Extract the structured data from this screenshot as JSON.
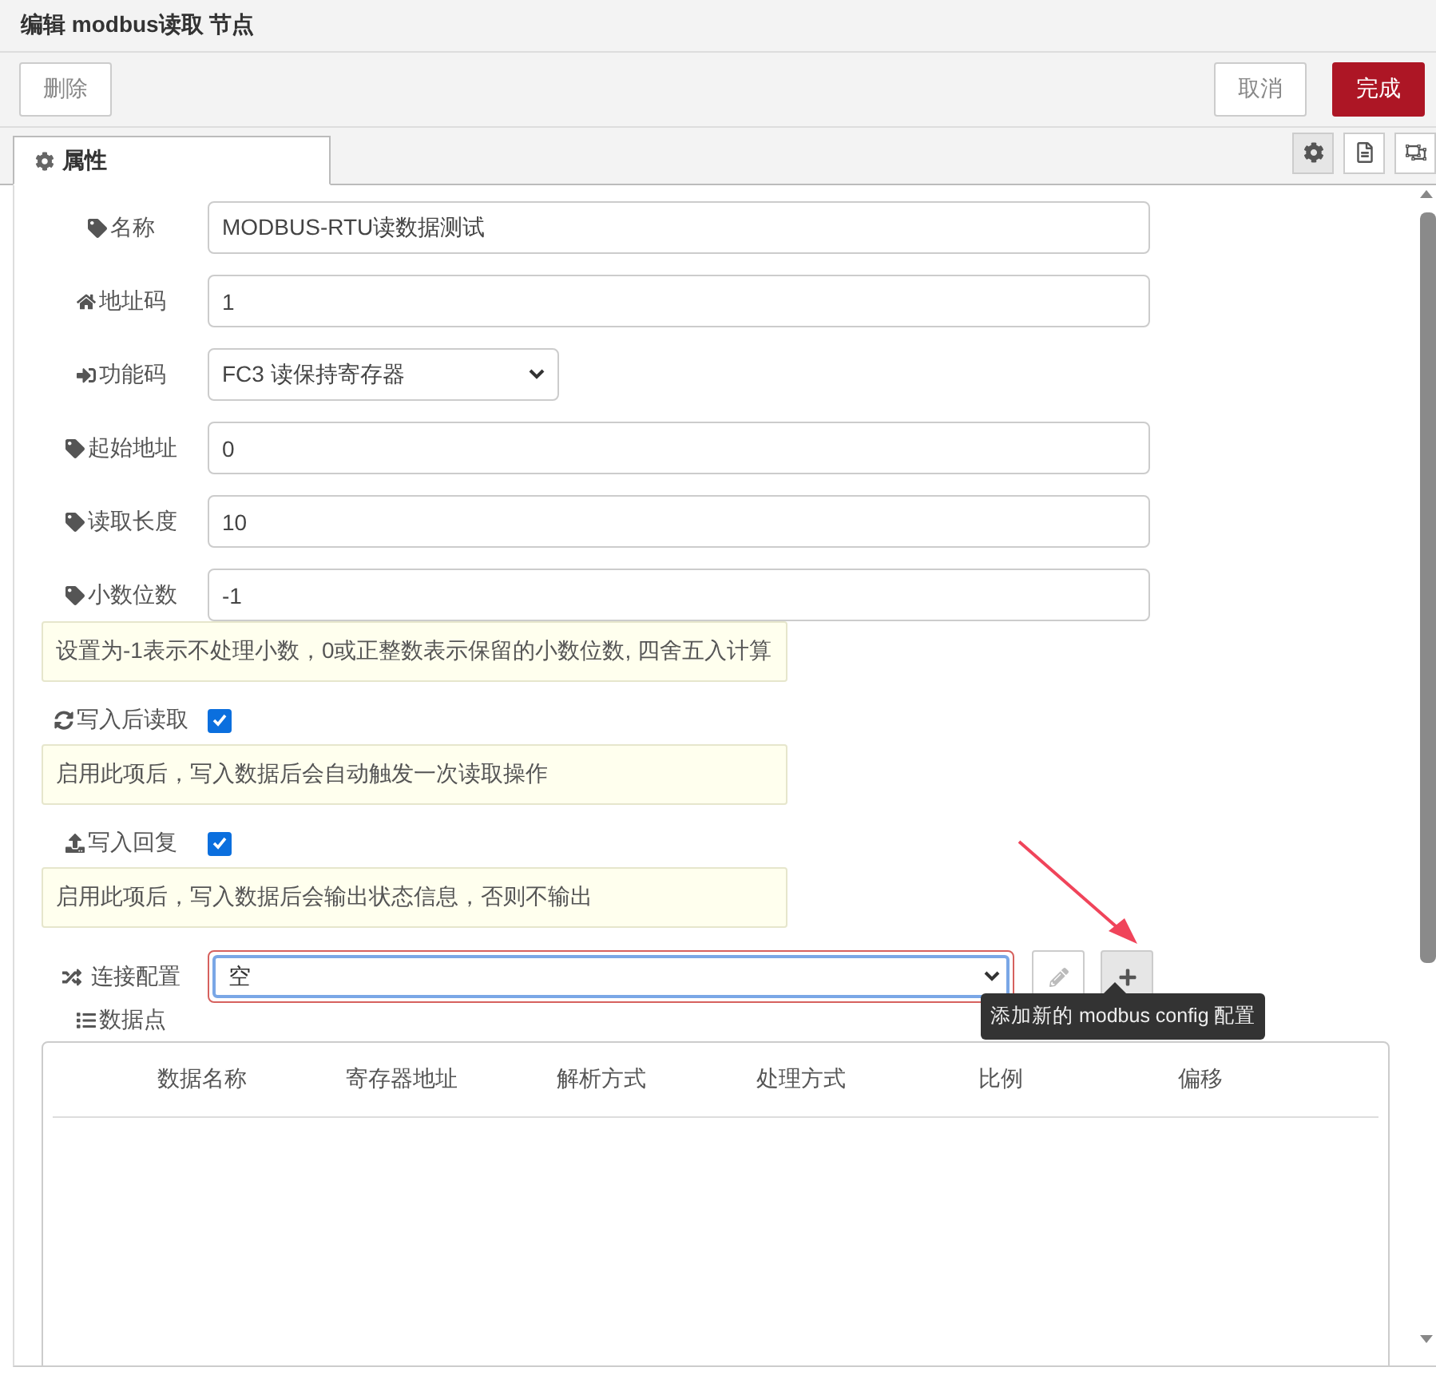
{
  "title": "编辑 modbus读取 节点",
  "buttons": {
    "delete": "删除",
    "cancel": "取消",
    "done": "完成"
  },
  "tabs": [
    {
      "label": "属性",
      "selected": true
    }
  ],
  "side_tabs": [
    {
      "selected": true
    },
    {
      "selected": false
    },
    {
      "selected": false
    }
  ],
  "fields": [
    {
      "kind": "text",
      "label": "名称",
      "value": "MODBUS-RTU读数据测试"
    },
    {
      "kind": "text",
      "label": "地址码",
      "value": "1"
    },
    {
      "kind": "select",
      "label": "功能码",
      "value": "FC3 读保持寄存器"
    },
    {
      "kind": "text",
      "label": "起始地址",
      "value": "0"
    },
    {
      "kind": "text",
      "label": "读取长度",
      "value": "10"
    },
    {
      "kind": "text",
      "label": "小数位数",
      "value": "-1"
    }
  ],
  "decimal_tip": "设置为-1表示不处理小数，0或正整数表示保留的小数位数, 四舍五入计算",
  "options": [
    {
      "label": "写入后读取",
      "checked": true,
      "tip": "启用此项后，写入数据后会自动触发一次读取操作"
    },
    {
      "label": "写入回复",
      "checked": true,
      "tip": "启用此项后，写入数据后会输出状态信息，否则不输出"
    }
  ],
  "connection": {
    "label": "连接配置",
    "value": "空",
    "invalid": true
  },
  "add_tooltip": "添加新的 modbus config 配置",
  "datapoints": {
    "label": "数据点",
    "columns": [
      "数据名称",
      "寄存器地址",
      "解析方式",
      "处理方式",
      "比例",
      "偏移"
    ]
  }
}
